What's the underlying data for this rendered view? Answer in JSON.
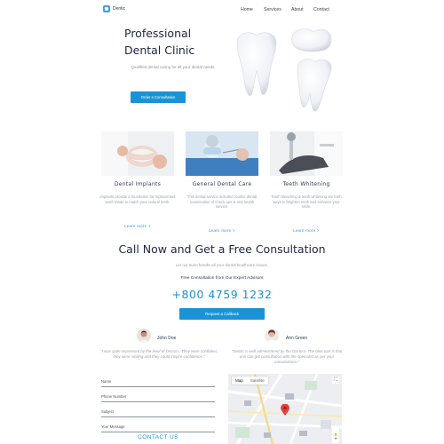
{
  "brand": {
    "name": "Dentic"
  },
  "nav": {
    "items": [
      "Home",
      "Services",
      "About",
      "Contact"
    ]
  },
  "hero": {
    "title_line1": "Professional",
    "title_line2": "Dental Clinic",
    "subtitle": "Qualified dental caring for all your dental needs.",
    "button": "Order a Consultation"
  },
  "services": [
    {
      "title": "Dental Implants",
      "text": "Implants provide a foundation for replacement teeth made to match your natural teeth.",
      "link": "Learn more >"
    },
    {
      "title": "General Dental Care",
      "text": "This dental service included routine dental examination of check-ups & oral health service.",
      "link": "Learn more >"
    },
    {
      "title": "Teeth Whitening",
      "text": "Teeth bleaching & teeth whitening are both ways to brighten teeth and enhance your smile.",
      "link": "Learn more >"
    }
  ],
  "consult": {
    "title": "Call Now and Get a Free Consultation",
    "subtitle": "Let our team handle all your dental healthcare issues.",
    "advisors": "Free Consultation from Our Expert Advisors",
    "phone": "+800 4759 1232",
    "button": "Request a Callback"
  },
  "testimonials": [
    {
      "name": "John Doe",
      "text": "\"I was quite impressed by the level of Doctors. They were confident, they were smiling and they could inspire confidence.\""
    },
    {
      "name": "Ann Green",
      "text": "\"Dentic is well-administered by the Doctors. The best part is that one can get consultation with the specialist as per your convenience.\""
    }
  ],
  "form": {
    "fields": [
      "Name",
      "Phone Number",
      "Subject",
      "Your Message"
    ],
    "contact_label": "CONTACT US"
  },
  "map": {
    "tab_map": "Map",
    "tab_satellite": "Satellite"
  },
  "colors": {
    "accent": "#1a93d6",
    "heading": "#1d2640",
    "muted": "#9aa1b0"
  }
}
